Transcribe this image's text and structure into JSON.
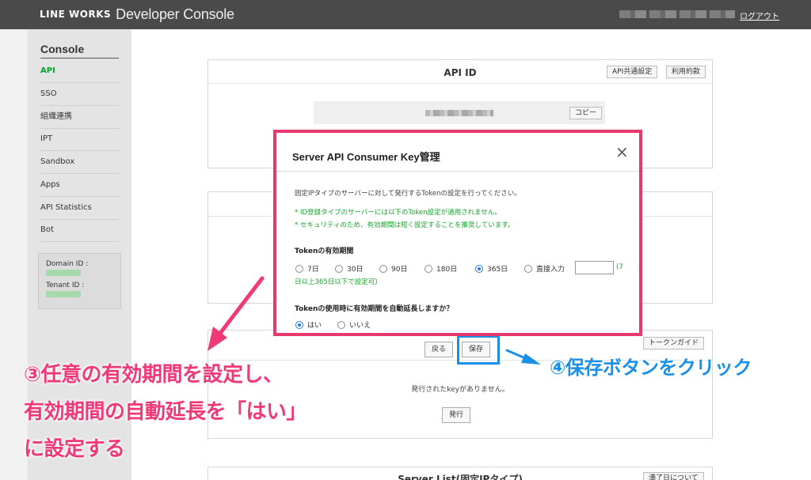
{
  "header": {
    "brand_short": "LINE WORKS",
    "brand_name": "Developer Console",
    "logout": "ログアウト"
  },
  "sidebar": {
    "title": "Console",
    "items": [
      {
        "label": "API",
        "active": true
      },
      {
        "label": "SSO"
      },
      {
        "label": "組織連携"
      },
      {
        "label": "IPT"
      },
      {
        "label": "Sandbox"
      },
      {
        "label": "Apps"
      },
      {
        "label": "API Statistics"
      },
      {
        "label": "Bot"
      }
    ],
    "domain_id_label": "Domain ID :",
    "tenant_id_label": "Tenant ID :"
  },
  "api_id_panel": {
    "title": "API ID",
    "common_settings": "API共通設定",
    "terms": "利用約款",
    "copy": "コピー"
  },
  "token_panel": {
    "guide": "トークンガイド",
    "back": "戻る",
    "save": "保存",
    "no_keys": "発行されたkeyがありません。",
    "issue": "発行"
  },
  "server_list_panel": {
    "title": "Server List(固定IPタイプ)",
    "expiry": "満了日について"
  },
  "modal": {
    "title": "Server API Consumer Key管理",
    "close": "×",
    "description": "固定IPタイプのサーバーに対して発行するTokenの設定を行ってください。",
    "note1": "* ID登録タイプのサーバーには以下のToken設定が適用されません。",
    "note2": "* セキュリティのため、有効期間は短く設定することを推奨しています。",
    "validity_label": "Tokenの有効期間",
    "validity_options": [
      "7日",
      "30日",
      "90日",
      "180日",
      "365日",
      "直接入力"
    ],
    "validity_selected": "365日",
    "direct_input_value": "",
    "range_note_1": "(7",
    "range_note_2": "日以上365日以下で設定可)",
    "auto_extend_label": "Tokenの使用時に有効期間を自動延長しますか？",
    "auto_extend_options": [
      "はい",
      "いいえ"
    ],
    "auto_extend_selected": "はい"
  },
  "annotations": {
    "step3_line1": "③任意の有効期間を設定し、",
    "step3_line2": "有効期間の自動延長を「はい」",
    "step3_line3": "に設定する",
    "step4": "④保存ボタンをクリック"
  },
  "colors": {
    "accent_green": "#00a52b",
    "highlight_pink": "#e8386e",
    "highlight_blue": "#1a8fe8",
    "topbar": "#4a4a4a"
  }
}
